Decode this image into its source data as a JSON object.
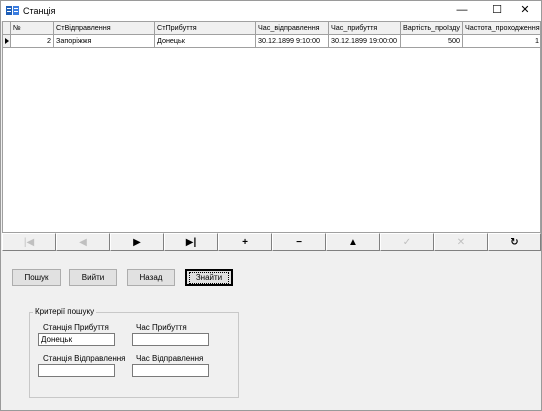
{
  "window": {
    "title": "Станція",
    "controls": {
      "minimize": "—",
      "maximize": "☐",
      "close": "✕"
    }
  },
  "grid": {
    "columns": [
      "№",
      "СтВідправлення",
      "СтПрибуття",
      "Час_відправлення",
      "Час_прибуття",
      "Вартість_проїзду",
      "Частота_проходження"
    ],
    "rows": [
      {
        "num": "2",
        "dep_station": "Запоріжжя",
        "arr_station": "Донецьк",
        "dep_time": "30.12.1899 9:10:00",
        "arr_time": "30.12.1899 19:00:00",
        "price": "500",
        "frequency": "1"
      }
    ]
  },
  "navigator": {
    "buttons": [
      {
        "name": "first",
        "icon": "first-record-icon",
        "glyph": "|◀",
        "enabled": false
      },
      {
        "name": "prior",
        "icon": "prior-record-icon",
        "glyph": "◀",
        "enabled": false
      },
      {
        "name": "next",
        "icon": "next-record-icon",
        "glyph": "▶",
        "enabled": true
      },
      {
        "name": "last",
        "icon": "last-record-icon",
        "glyph": "▶|",
        "enabled": true
      },
      {
        "name": "insert",
        "icon": "plus-icon",
        "glyph": "+",
        "enabled": true
      },
      {
        "name": "delete",
        "icon": "minus-icon",
        "glyph": "−",
        "enabled": true
      },
      {
        "name": "edit",
        "icon": "triangle-up-icon",
        "glyph": "▲",
        "enabled": true
      },
      {
        "name": "post",
        "icon": "checkmark-icon",
        "glyph": "✓",
        "enabled": false
      },
      {
        "name": "cancel",
        "icon": "cross-icon",
        "glyph": "✕",
        "enabled": false
      },
      {
        "name": "refresh",
        "icon": "refresh-icon",
        "glyph": "↻",
        "enabled": true
      }
    ]
  },
  "actions": {
    "search": "Пошук",
    "exit": "Вийти",
    "back": "Назад",
    "find": "Знайти"
  },
  "criteria": {
    "title": "Критерії пошуку",
    "arrival_station_label": "Станція Прибуття",
    "arrival_station_value": "Донецьк",
    "arrival_time_label": "Час Прибуття",
    "arrival_time_value": "",
    "departure_station_label": "Станція Відправлення",
    "departure_station_value": "",
    "departure_time_label": "Час Відправлення",
    "departure_time_value": ""
  }
}
